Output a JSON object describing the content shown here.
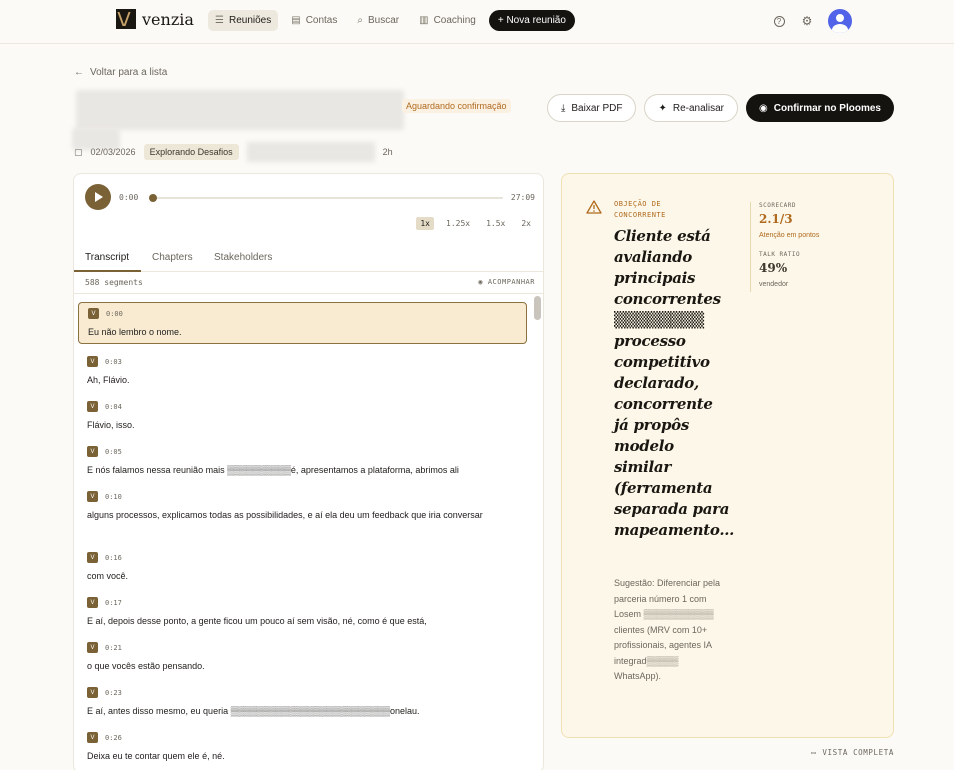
{
  "brand": {
    "name": "venzia"
  },
  "nav": {
    "items": [
      {
        "label": "Reuniões",
        "icon": "list-icon",
        "active": true
      },
      {
        "label": "Contas",
        "icon": "building-icon",
        "active": false
      },
      {
        "label": "Buscar",
        "icon": "search-icon",
        "active": false
      },
      {
        "label": "Coaching",
        "icon": "bar-chart-icon",
        "active": false
      }
    ],
    "new_meeting": "+ Nova reunião"
  },
  "header": {
    "back": "Voltar para a lista",
    "status": "Aguardando confirmação",
    "date": "02/03/2026",
    "tag": "Explorando Desafios",
    "duration_suffix": "2h",
    "actions": {
      "download_pdf": "Baixar PDF",
      "reanalyze": "Re-analisar",
      "confirm": "Confirmar no Ploomes"
    }
  },
  "player": {
    "current": "0:00",
    "total": "27:09",
    "speeds": [
      "1x",
      "1.25x",
      "1.5x",
      "2x"
    ],
    "active_speed": "1x"
  },
  "tabs": [
    "Transcript",
    "Chapters",
    "Stakeholders"
  ],
  "transcript": {
    "segment_count": "588 segments",
    "follow": "ACOMPANHAR",
    "speaker_initial": "V",
    "segments": [
      {
        "time": "0:00",
        "text": "Eu não lembro o nome."
      },
      {
        "time": "0:03",
        "text": "Ah, Flávio."
      },
      {
        "time": "0:04",
        "text": "Flávio, isso."
      },
      {
        "time": "0:05",
        "text": "E nós falamos nessa reunião mais ▒▒▒▒▒▒▒▒▒▒é, apresentamos a plataforma, abrimos ali"
      },
      {
        "time": "0:10",
        "text": "alguns processos, explicamos todas as possibilidades, e aí ela deu um feedback que iria conversar"
      },
      {
        "time": "0:16",
        "text": "com você."
      },
      {
        "time": "0:17",
        "text": "E aí, depois desse ponto, a gente ficou um pouco aí sem visão, né, como é que está,"
      },
      {
        "time": "0:21",
        "text": "o que vocês estão pensando."
      },
      {
        "time": "0:23",
        "text": "E aí, antes disso mesmo, eu queria ▒▒▒▒▒▒▒▒▒▒▒▒▒▒▒▒▒▒▒▒▒▒▒▒▒onelau."
      },
      {
        "time": "0:26",
        "text": "Deixa eu te contar quem ele é, né."
      }
    ]
  },
  "insight": {
    "label": "OBJEÇÃO DE CONCORRENTE",
    "title": "Cliente está avaliando principais concorrentes ▒▒▒▒▒▒▒▒ processo competitivo declarado, concorrente já propôs modelo similar (ferramenta separada para mapeamento...",
    "suggestion": "Sugestão: Diferenciar pela parceria número 1 com Losem ▒▒▒▒▒▒▒▒▒▒▒ clientes (MRV com 10+ profissionais, agentes IA integrad▒▒▒▒▒ WhatsApp).",
    "scorecard_label": "SCORECARD",
    "scorecard_value": "2.1/3",
    "scorecard_note": "Atenção em pontos",
    "talk_ratio_label": "TALK RATIO",
    "talk_ratio_value": "49%",
    "talk_ratio_note": "vendedor"
  },
  "footer": {
    "full_view": "VISTA COMPLETA"
  },
  "colors": {
    "accent": "#7a6236",
    "warning": "#b06a1e",
    "brand_dark": "#141310",
    "avatar": "#5163e8"
  }
}
